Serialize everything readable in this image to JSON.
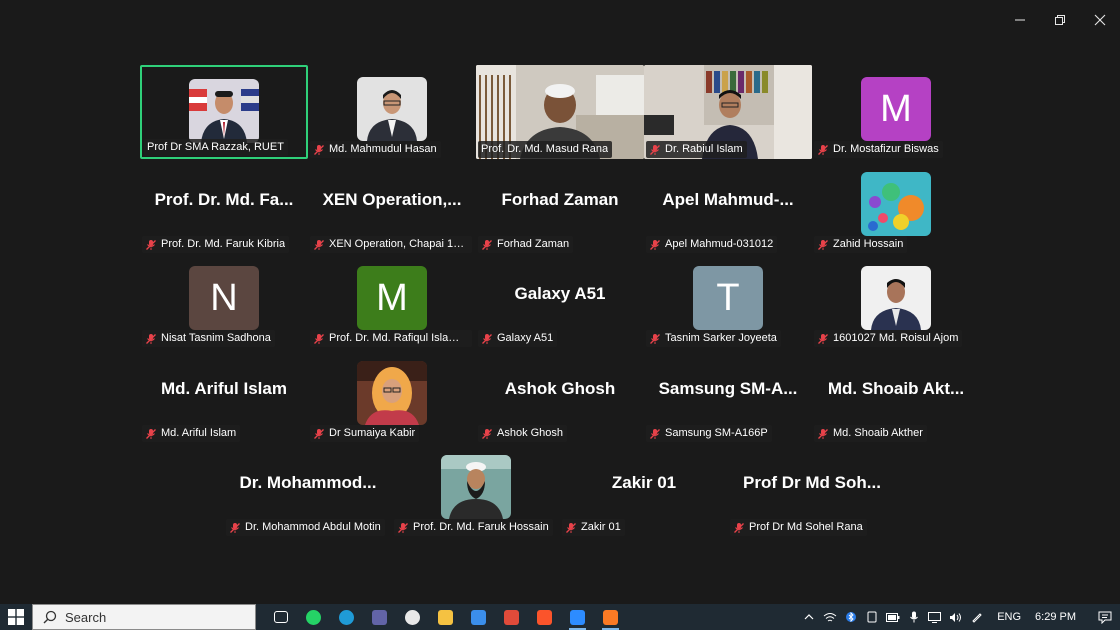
{
  "window": {
    "controls": [
      "minimize",
      "restore",
      "close"
    ]
  },
  "tiles": [
    {
      "id": "razzak",
      "label": "Prof Dr SMA Razzak, RUET",
      "kind": "photo",
      "active": true,
      "muted": false
    },
    {
      "id": "hasan",
      "label": "Md. Mahmudul Hasan",
      "kind": "photo",
      "muted": true
    },
    {
      "id": "masud",
      "label": "Prof. Dr. Md. Masud Rana",
      "kind": "video",
      "muted": false
    },
    {
      "id": "rabiul",
      "label": "Dr. Rabiul Islam",
      "kind": "video",
      "muted": true
    },
    {
      "id": "mostafizur",
      "label": "Dr. Mostafizur Biswas",
      "kind": "avatar",
      "letter": "M",
      "color": "#b541c4",
      "muted": true
    },
    {
      "id": "faruk-kibria",
      "name": "Prof. Dr. Md. Fa...",
      "label": "Prof. Dr. Md. Faruk Kibria",
      "kind": "name",
      "muted": true
    },
    {
      "id": "xen",
      "name": "XEN Operation,...",
      "label": "XEN Operation, Chapai 100...",
      "kind": "name",
      "muted": true
    },
    {
      "id": "forhad",
      "name": "Forhad Zaman",
      "label": "Forhad Zaman",
      "kind": "name",
      "muted": true
    },
    {
      "id": "apel",
      "name": "Apel Mahmud-...",
      "label": "Apel Mahmud-031012",
      "kind": "name",
      "muted": true
    },
    {
      "id": "zahid",
      "label": "Zahid Hossain",
      "kind": "balloons",
      "muted": true
    },
    {
      "id": "nisat",
      "label": "Nisat Tasnim Sadhona",
      "kind": "avatar",
      "letter": "N",
      "color": "#5b4640",
      "muted": true
    },
    {
      "id": "rafiqul",
      "label": "Prof. Dr. Md. Rafiqul Islam S...",
      "kind": "avatar",
      "letter": "M",
      "color": "#3d7d1b",
      "muted": true
    },
    {
      "id": "galaxy",
      "name": "Galaxy A51",
      "label": "Galaxy A51",
      "kind": "name",
      "muted": true
    },
    {
      "id": "tasnim",
      "label": "Tasnim Sarker Joyeeta",
      "kind": "avatar",
      "letter": "T",
      "color": "#7e97a4",
      "muted": true
    },
    {
      "id": "roisul",
      "label": "1601027 Md. Roisul Ajom",
      "kind": "photo",
      "muted": true
    },
    {
      "id": "ariful",
      "name": "Md. Ariful Islam",
      "label": "Md. Ariful Islam",
      "kind": "name",
      "muted": true
    },
    {
      "id": "sumaiya",
      "label": "Dr Sumaiya Kabir",
      "kind": "photo",
      "muted": true
    },
    {
      "id": "ashok",
      "name": "Ashok Ghosh",
      "label": "Ashok Ghosh",
      "kind": "name",
      "muted": true
    },
    {
      "id": "samsung",
      "name": "Samsung SM-A...",
      "label": "Samsung SM-A166P",
      "kind": "name",
      "muted": true
    },
    {
      "id": "shoaib",
      "name": "Md. Shoaib Akt...",
      "label": "Md. Shoaib Akther",
      "kind": "name",
      "muted": true
    },
    {
      "id": "motin",
      "name": "Dr. Mohammod...",
      "label": "Dr. Mohammod Abdul Motin",
      "kind": "name",
      "muted": true
    },
    {
      "id": "faruk-hossain",
      "label": "Prof. Dr. Md. Faruk Hossain",
      "kind": "photo",
      "muted": true
    },
    {
      "id": "zakir",
      "name": "Zakir 01",
      "label": "Zakir 01",
      "kind": "name",
      "muted": true
    },
    {
      "id": "sohel",
      "name": "Prof Dr Md Soh...",
      "label": "Prof Dr Md Sohel Rana",
      "kind": "name",
      "muted": true
    }
  ],
  "taskbar": {
    "search_label": "Search",
    "apps": [
      {
        "name": "task-view-icon",
        "color": "#ffffff"
      },
      {
        "name": "whatsapp-icon",
        "color": "#25d366"
      },
      {
        "name": "edge-icon",
        "color": "#1f9bd7"
      },
      {
        "name": "teams-icon",
        "color": "#6264a7"
      },
      {
        "name": "paint-icon",
        "color": "#e8e8e8"
      },
      {
        "name": "file-explorer-icon",
        "color": "#f5c242"
      },
      {
        "name": "todo-icon",
        "color": "#3b8eea"
      },
      {
        "name": "app-red-icon",
        "color": "#e04b3a"
      },
      {
        "name": "brave-icon",
        "color": "#fb542b"
      },
      {
        "name": "zoom-icon",
        "color": "#2d8cff"
      },
      {
        "name": "xampp-icon",
        "color": "#fb7a24"
      }
    ],
    "lang": "ENG",
    "time": "6:29 PM"
  }
}
